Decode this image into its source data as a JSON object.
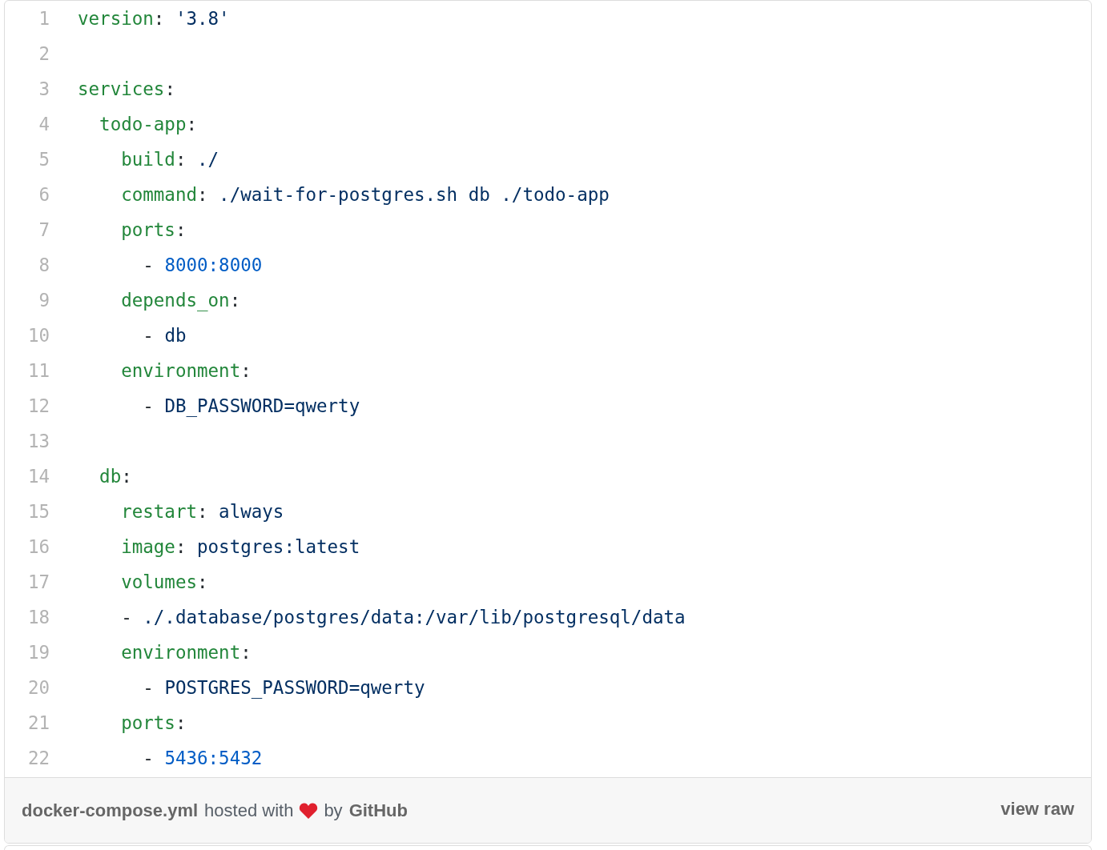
{
  "code": {
    "lines": [
      {
        "number": "1",
        "tokens": [
          {
            "kind": "key",
            "text": "version"
          },
          {
            "kind": "punct",
            "text": ": "
          },
          {
            "kind": "str",
            "text": "'3.8'"
          }
        ]
      },
      {
        "number": "2"
      },
      {
        "number": "3",
        "tokens": [
          {
            "kind": "key",
            "text": "services"
          },
          {
            "kind": "punct",
            "text": ":"
          }
        ]
      },
      {
        "number": "4",
        "tokens": [
          {
            "kind": "key",
            "text": "  todo-app"
          },
          {
            "kind": "punct",
            "text": ":"
          }
        ]
      },
      {
        "number": "5",
        "tokens": [
          {
            "kind": "key",
            "text": "    build"
          },
          {
            "kind": "punct",
            "text": ": "
          },
          {
            "kind": "str",
            "text": "./"
          }
        ]
      },
      {
        "number": "6",
        "tokens": [
          {
            "kind": "key",
            "text": "    command"
          },
          {
            "kind": "punct",
            "text": ": "
          },
          {
            "kind": "str",
            "text": "./wait-for-postgres.sh db ./todo-app"
          }
        ]
      },
      {
        "number": "7",
        "tokens": [
          {
            "kind": "key",
            "text": "    ports"
          },
          {
            "kind": "punct",
            "text": ":"
          }
        ]
      },
      {
        "number": "8",
        "tokens": [
          {
            "kind": "punct",
            "text": "      - "
          },
          {
            "kind": "num",
            "text": "8000:8000"
          }
        ]
      },
      {
        "number": "9",
        "tokens": [
          {
            "kind": "key",
            "text": "    depends_on"
          },
          {
            "kind": "punct",
            "text": ":"
          }
        ]
      },
      {
        "number": "10",
        "tokens": [
          {
            "kind": "punct",
            "text": "      - "
          },
          {
            "kind": "str",
            "text": "db"
          }
        ]
      },
      {
        "number": "11",
        "tokens": [
          {
            "kind": "key",
            "text": "    environment"
          },
          {
            "kind": "punct",
            "text": ":"
          }
        ]
      },
      {
        "number": "12",
        "tokens": [
          {
            "kind": "punct",
            "text": "      - "
          },
          {
            "kind": "str",
            "text": "DB_PASSWORD=qwerty"
          }
        ]
      },
      {
        "number": "13"
      },
      {
        "number": "14",
        "tokens": [
          {
            "kind": "key",
            "text": "  db"
          },
          {
            "kind": "punct",
            "text": ":"
          }
        ]
      },
      {
        "number": "15",
        "tokens": [
          {
            "kind": "key",
            "text": "    restart"
          },
          {
            "kind": "punct",
            "text": ": "
          },
          {
            "kind": "str",
            "text": "always"
          }
        ]
      },
      {
        "number": "16",
        "tokens": [
          {
            "kind": "key",
            "text": "    image"
          },
          {
            "kind": "punct",
            "text": ": "
          },
          {
            "kind": "str",
            "text": "postgres:latest"
          }
        ]
      },
      {
        "number": "17",
        "tokens": [
          {
            "kind": "key",
            "text": "    volumes"
          },
          {
            "kind": "punct",
            "text": ":"
          }
        ]
      },
      {
        "number": "18",
        "tokens": [
          {
            "kind": "punct",
            "text": "    - "
          },
          {
            "kind": "str",
            "text": "./.database/postgres/data:/var/lib/postgresql/data"
          }
        ]
      },
      {
        "number": "19",
        "tokens": [
          {
            "kind": "key",
            "text": "    environment"
          },
          {
            "kind": "punct",
            "text": ":"
          }
        ]
      },
      {
        "number": "20",
        "tokens": [
          {
            "kind": "punct",
            "text": "      - "
          },
          {
            "kind": "str",
            "text": "POSTGRES_PASSWORD=qwerty"
          }
        ]
      },
      {
        "number": "21",
        "tokens": [
          {
            "kind": "key",
            "text": "    ports"
          },
          {
            "kind": "punct",
            "text": ":"
          }
        ]
      },
      {
        "number": "22",
        "tokens": [
          {
            "kind": "punct",
            "text": "      - "
          },
          {
            "kind": "num",
            "text": "5436:5432"
          }
        ]
      }
    ]
  },
  "footer": {
    "filename": "docker-compose.yml",
    "hosted_text": "hosted with",
    "by_text": "by",
    "brand": "GitHub",
    "view_raw": "view raw"
  }
}
